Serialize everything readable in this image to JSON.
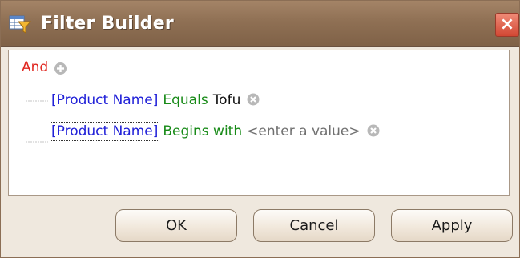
{
  "window": {
    "title": "Filter Builder",
    "close_label": "×"
  },
  "filter": {
    "group_operator": "And",
    "conditions": [
      {
        "field": "[Product Name]",
        "operator": "Equals",
        "value": "Tofu"
      },
      {
        "field": "[Product Name]",
        "operator": "Begins with",
        "value_placeholder": "<enter a value>"
      }
    ]
  },
  "buttons": {
    "ok": "OK",
    "cancel": "Cancel",
    "apply": "Apply"
  },
  "colors": {
    "group_operator": "#e0261f",
    "field": "#2020d8",
    "operator": "#178a17",
    "titlebar": "#8f7054"
  }
}
